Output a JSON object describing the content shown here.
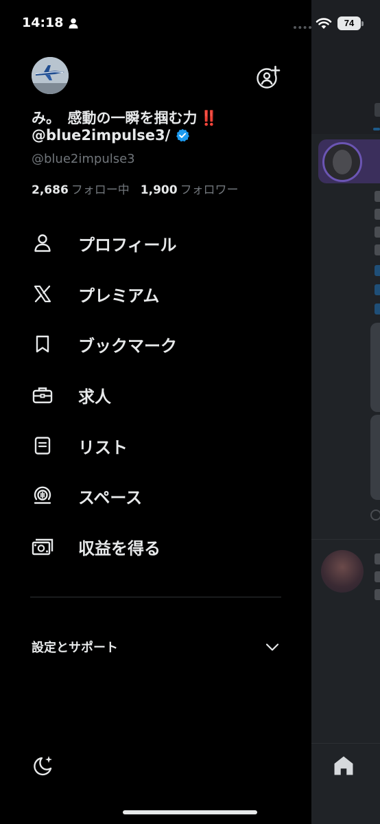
{
  "status_bar": {
    "time": "14:18",
    "battery": "74"
  },
  "profile": {
    "display_name": "み。　感動の一瞬を掴む力",
    "display_name_emoji": "‼️",
    "display_name_line2": "@blue2impulse3/",
    "handle": "@blue2impulse3",
    "following_count": "2,686",
    "following_label": "フォロー中",
    "followers_count": "1,900",
    "followers_label": "フォロワー"
  },
  "menu": {
    "items": [
      {
        "label": "プロフィール",
        "icon": "person-icon"
      },
      {
        "label": "プレミアム",
        "icon": "x-logo-icon"
      },
      {
        "label": "ブックマーク",
        "icon": "bookmark-icon"
      },
      {
        "label": "求人",
        "icon": "briefcase-icon"
      },
      {
        "label": "リスト",
        "icon": "list-icon"
      },
      {
        "label": "スペース",
        "icon": "spaces-icon"
      },
      {
        "label": "収益を得る",
        "icon": "monetization-icon"
      }
    ]
  },
  "settings": {
    "label": "設定とサポート"
  },
  "colors": {
    "background": "#000000",
    "text_primary": "#e7e9ea",
    "text_secondary": "#71767b",
    "verified_blue": "#1d9bf0",
    "divider": "#2f3336",
    "overlay_feed": "#202327"
  }
}
